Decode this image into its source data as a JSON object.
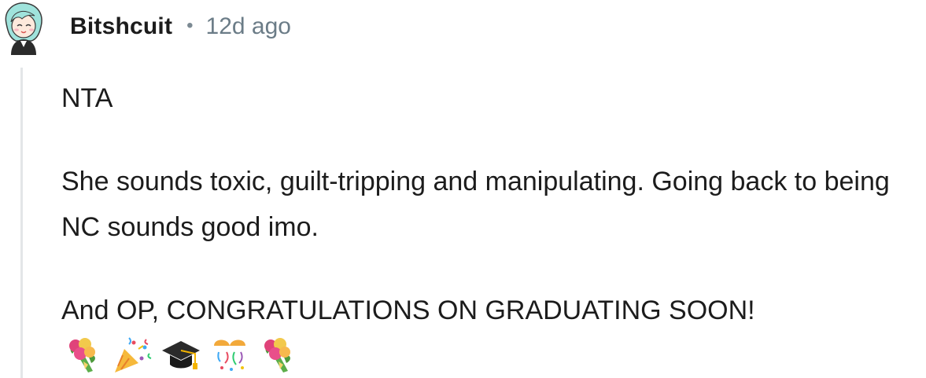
{
  "comment": {
    "username": "Bitshcuit",
    "separator": "•",
    "timestamp": "12d ago",
    "paragraphs": [
      "NTA",
      "She sounds toxic, guilt-tripping and manipulating. Going back to being NC sounds good imo.",
      "And OP, CONGRATULATIONS ON GRADUATING SOON!"
    ],
    "emojis": [
      "bouquet-icon",
      "party-popper-icon",
      "graduation-cap-icon",
      "confetti-ball-icon",
      "bouquet-icon"
    ]
  },
  "colors": {
    "username": "#1c1c1c",
    "meta": "#6b7c87",
    "thread_line": "#e3e6e8",
    "avatar_hair": "#9fe3dc"
  }
}
